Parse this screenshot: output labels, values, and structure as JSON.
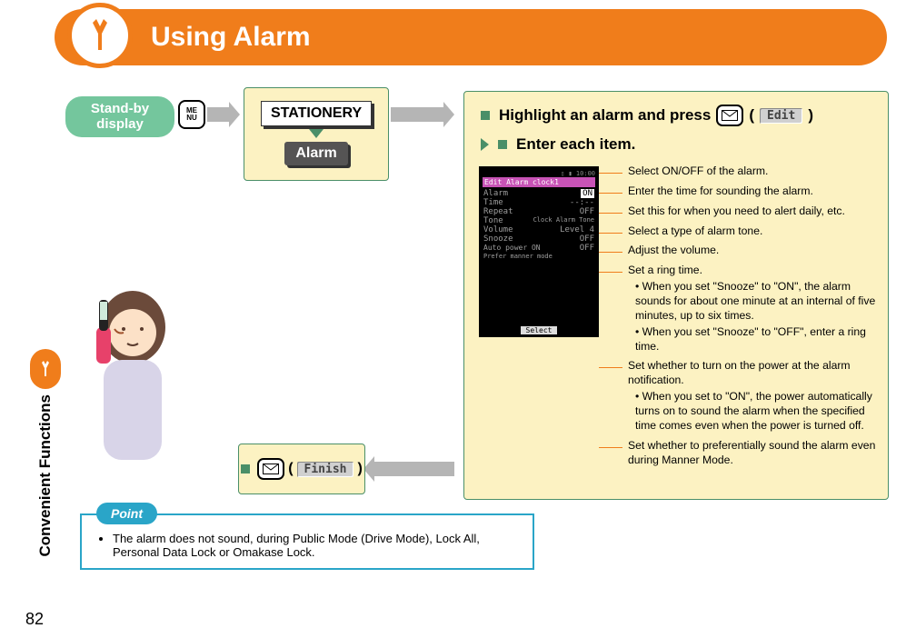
{
  "header": {
    "title": "Using Alarm"
  },
  "side": {
    "label": "Convenient Functions",
    "page": "82"
  },
  "standby": {
    "line1": "Stand-by",
    "line2": "display"
  },
  "menu_key": {
    "l1": "ME",
    "l2": "NU"
  },
  "step1": {
    "stationery": "STATIONERY",
    "alarm": "Alarm"
  },
  "big": {
    "title_a": "Highlight an alarm and press",
    "edit_btn": "Edit",
    "title_b": "Enter each item.",
    "items": {
      "i1": "Select ON/OFF of the alarm.",
      "i2": "Enter the time for sounding the alarm.",
      "i3": "Set this for when you need to alert daily, etc.",
      "i4": "Select a type of alarm tone.",
      "i5": "Adjust the volume.",
      "i6": "Set a ring time.",
      "i6a": "• When you set \"Snooze\" to \"ON\", the alarm sounds for about one minute at an internal of five minutes, up to six times.",
      "i6b": "• When you set \"Snooze\" to \"OFF\", enter a ring time.",
      "i7": "Set whether to turn on the power at the alarm notification.",
      "i7a": "• When you set to \"ON\", the power automatically turns on to sound the alarm when the specified time comes even when the power is turned off.",
      "i8": "Set whether to preferentially sound the alarm even during Manner Mode."
    }
  },
  "phone": {
    "header": "Edit Alarm clock1",
    "rows": {
      "r1l": "Alarm",
      "r1r": "ON",
      "r2l": "Time",
      "r2r": "--:--",
      "r3l": "Repeat",
      "r3r": "OFF",
      "r4l": "Tone",
      "r4r": "Clock Alarm Tone",
      "r5l": "Volume",
      "r5r": "Level 4",
      "r6l": "Snooze",
      "r6r": "OFF",
      "r7l": "Auto power ON",
      "r7r": "OFF",
      "r8l": "Prefer manner mode",
      "r8r": ""
    },
    "select": "Select"
  },
  "finish": {
    "btn": "Finish"
  },
  "point": {
    "badge": "Point",
    "text": "The alarm does not sound, during Public Mode (Drive Mode), Lock All, Personal Data Lock or Omakase Lock."
  }
}
